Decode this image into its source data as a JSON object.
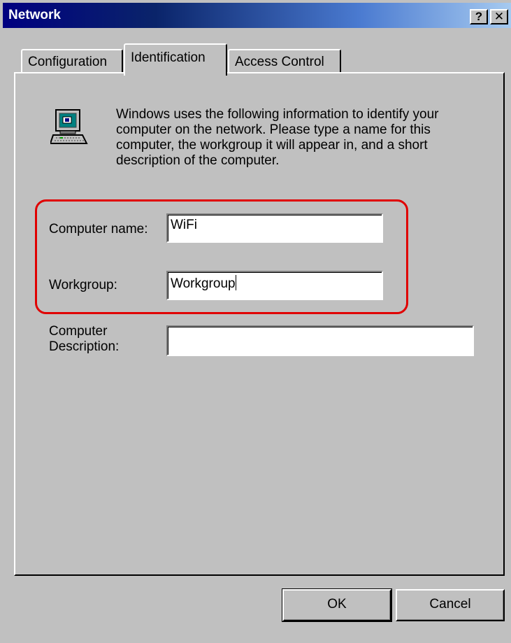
{
  "window": {
    "title": "Network",
    "help_label": "?",
    "close_label": "✕"
  },
  "tabs": [
    {
      "label": "Configuration",
      "selected": false
    },
    {
      "label": "Identification",
      "selected": true
    },
    {
      "label": "Access Control",
      "selected": false
    }
  ],
  "identification": {
    "icon": "computer-icon",
    "info_text": "Windows uses the following information to identify your computer on the network.  Please type a name for this computer, the workgroup it will appear in, and a short description of the computer.",
    "computer_name": {
      "label": "Computer name:",
      "value": "WiFi"
    },
    "workgroup": {
      "label": "Workgroup:",
      "value": "Workgroup"
    },
    "description": {
      "label": "Computer Description:",
      "value": ""
    },
    "highlight_color": "#e00000"
  },
  "buttons": {
    "ok": "OK",
    "cancel": "Cancel"
  }
}
